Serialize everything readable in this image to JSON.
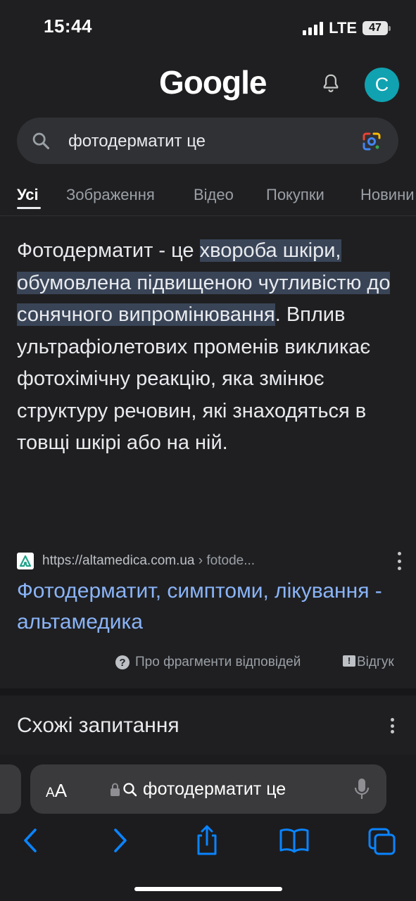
{
  "status": {
    "time": "15:44",
    "network": "LTE",
    "battery": "47"
  },
  "header": {
    "logo": "Google",
    "avatar_letter": "C"
  },
  "search": {
    "query": "фотодерматит це"
  },
  "tabs": [
    "Усі",
    "Зображення",
    "Відео",
    "Покупки",
    "Новини"
  ],
  "snippet": {
    "before": "Фотодерматит - це ",
    "highlight": "хвороба шкіри, обумовлена підвищеною чутливістю до сонячного випромінювання",
    "after": ". Вплив ультрафіолетових променів викликає фотохімічну реакцію, яка змінює структуру речовин, які знаходяться в товщі шкірі або на ній."
  },
  "source": {
    "url": "https://altamedica.com.ua",
    "crumb": " › fotode...",
    "title": "Фотодерматит, симптоми, лікування - альтамедика"
  },
  "feedback": {
    "about": "Про фрагменти відповідей",
    "feedback": "Відгук"
  },
  "related": {
    "title": "Схожі запитання"
  },
  "browser": {
    "aa_small": "A",
    "aa_big": "A",
    "url_text": "фотодерматит це"
  },
  "colors": {
    "background": "#1f1f21",
    "link": "#8ab4f8",
    "highlight": "#394457",
    "avatar": "#10a2b0",
    "ios_blue": "#0a84ff"
  }
}
